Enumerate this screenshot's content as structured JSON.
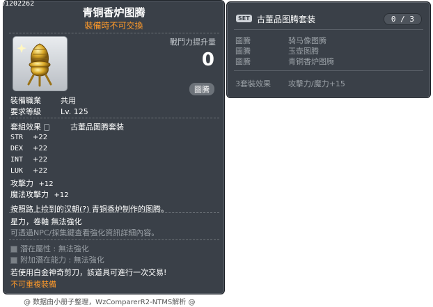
{
  "item_id": "01202262",
  "item": {
    "name": "青铜香炉图腾",
    "subtitle": "裝備時不可交換",
    "combat_power_label": "戰鬥力提升量",
    "combat_power_value": "0",
    "tag": "圖騰",
    "job_label": "裝備職業",
    "job_value": "共用",
    "level_label": "要求等級",
    "level_value": "Lv. 125",
    "set_effect_label": "套組效果",
    "set_effect_value": "古董品图腾套装",
    "stats": [
      {
        "key": "STR",
        "val": "+22"
      },
      {
        "key": "DEX",
        "val": "+22"
      },
      {
        "key": "INT",
        "val": "+22"
      },
      {
        "key": "LUK",
        "val": "+22"
      }
    ],
    "attack_label": "攻擊力",
    "attack_value": "+12",
    "magic_label": "魔法攻擊力",
    "magic_value": "+12",
    "description": "按照路上捡到的汉朝(?) 青铜香炉制作的图腾。",
    "star_line": "星力，卷軸 無法強化",
    "npc_line": "可透過NPC/採集鍵查看強化資訊詳細內容。",
    "potential_label": "潛在屬性 : 無法強化",
    "additional_label": "附加潛在能力 : 無法強化",
    "scissors_line": "若使用白金神奇剪刀，該道具可進行一次交易!",
    "unique_line": "不可重複裝備"
  },
  "set": {
    "badge": "SET",
    "name": "古董品图腾套装",
    "count": "0 / 3",
    "parts": [
      {
        "type": "圖騰",
        "name": "骑马像图腾"
      },
      {
        "type": "圖騰",
        "name": "玉壶图腾"
      },
      {
        "type": "圖騰",
        "name": "青铜香炉图腾"
      }
    ],
    "effect_label": "3套裝效果",
    "effect_value": "攻擊力/魔力+15"
  },
  "footer": "@ 数据由小册子整理，WzComparerR2-NTMS解析 @"
}
